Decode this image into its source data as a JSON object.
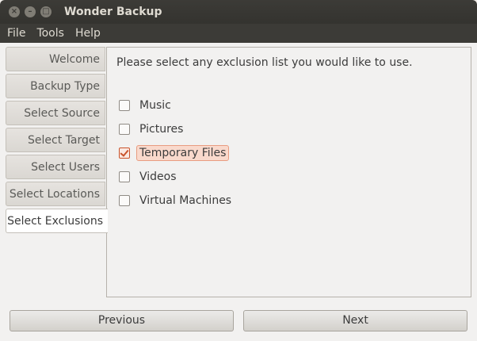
{
  "window": {
    "title": "Wonder Backup",
    "controls": [
      "close-icon",
      "minimize-icon",
      "maximize-icon"
    ]
  },
  "menubar": {
    "items": [
      "File",
      "Tools",
      "Help"
    ]
  },
  "sidebar": {
    "items": [
      {
        "label": "Welcome"
      },
      {
        "label": "Backup Type"
      },
      {
        "label": "Select Source"
      },
      {
        "label": "Select Target"
      },
      {
        "label": "Select Users"
      },
      {
        "label": "Select Locations"
      },
      {
        "label": "Select Exclusions",
        "active": true
      }
    ]
  },
  "main": {
    "prompt": "Please select any exclusion list you would like to use.",
    "options": [
      {
        "label": "Music",
        "checked": false
      },
      {
        "label": "Pictures",
        "checked": false
      },
      {
        "label": "Temporary Files",
        "checked": true,
        "focused": true
      },
      {
        "label": "Videos",
        "checked": false
      },
      {
        "label": "Virtual Machines",
        "checked": false
      }
    ]
  },
  "footer": {
    "previous_label": "Previous",
    "next_label": "Next"
  },
  "colors": {
    "titlebar": "#3c3b37",
    "accent": "#c9532b",
    "panel_bg": "#f2f1f0"
  }
}
